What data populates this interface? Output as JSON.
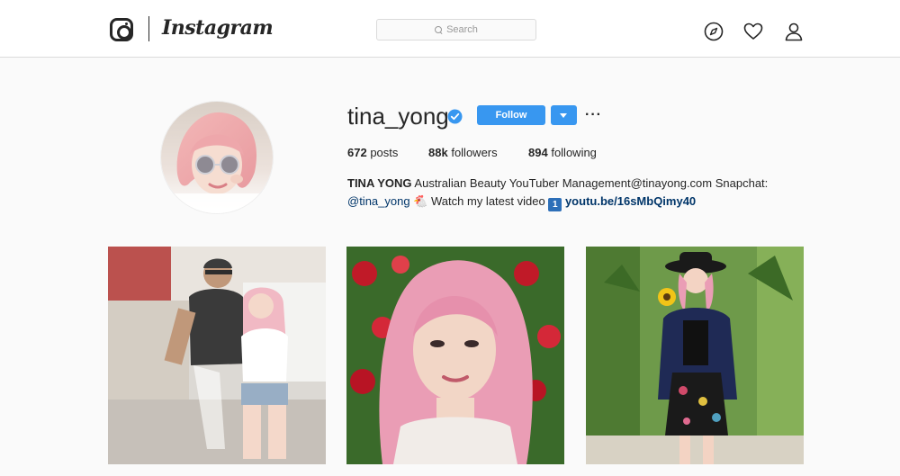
{
  "header": {
    "logo_text": "Instagram",
    "search_placeholder": "Search",
    "icons": [
      "compass-icon",
      "heart-icon",
      "person-icon"
    ]
  },
  "profile": {
    "username": "tina_yong",
    "verified": true,
    "follow_label": "Follow",
    "stats": {
      "posts_count": "672",
      "posts_label": "posts",
      "followers_count": "88k",
      "followers_label": "followers",
      "following_count": "894",
      "following_label": "following"
    },
    "bio": {
      "name": "TINA YONG",
      "line1_text": "Australian Beauty YouTuber Management@tinayong.com Snapchat:",
      "mention": "@tina_yong",
      "line2_text": "Watch my latest video",
      "emoji": "1",
      "link": "youtu.be/16sMbQimy40"
    }
  },
  "posts": [
    {
      "id": 1
    },
    {
      "id": 2
    },
    {
      "id": 3
    }
  ],
  "colors": {
    "accent": "#3897f0",
    "link": "#003569",
    "text": "#262626",
    "background": "#fafafa",
    "border": "#dbdbdb"
  }
}
